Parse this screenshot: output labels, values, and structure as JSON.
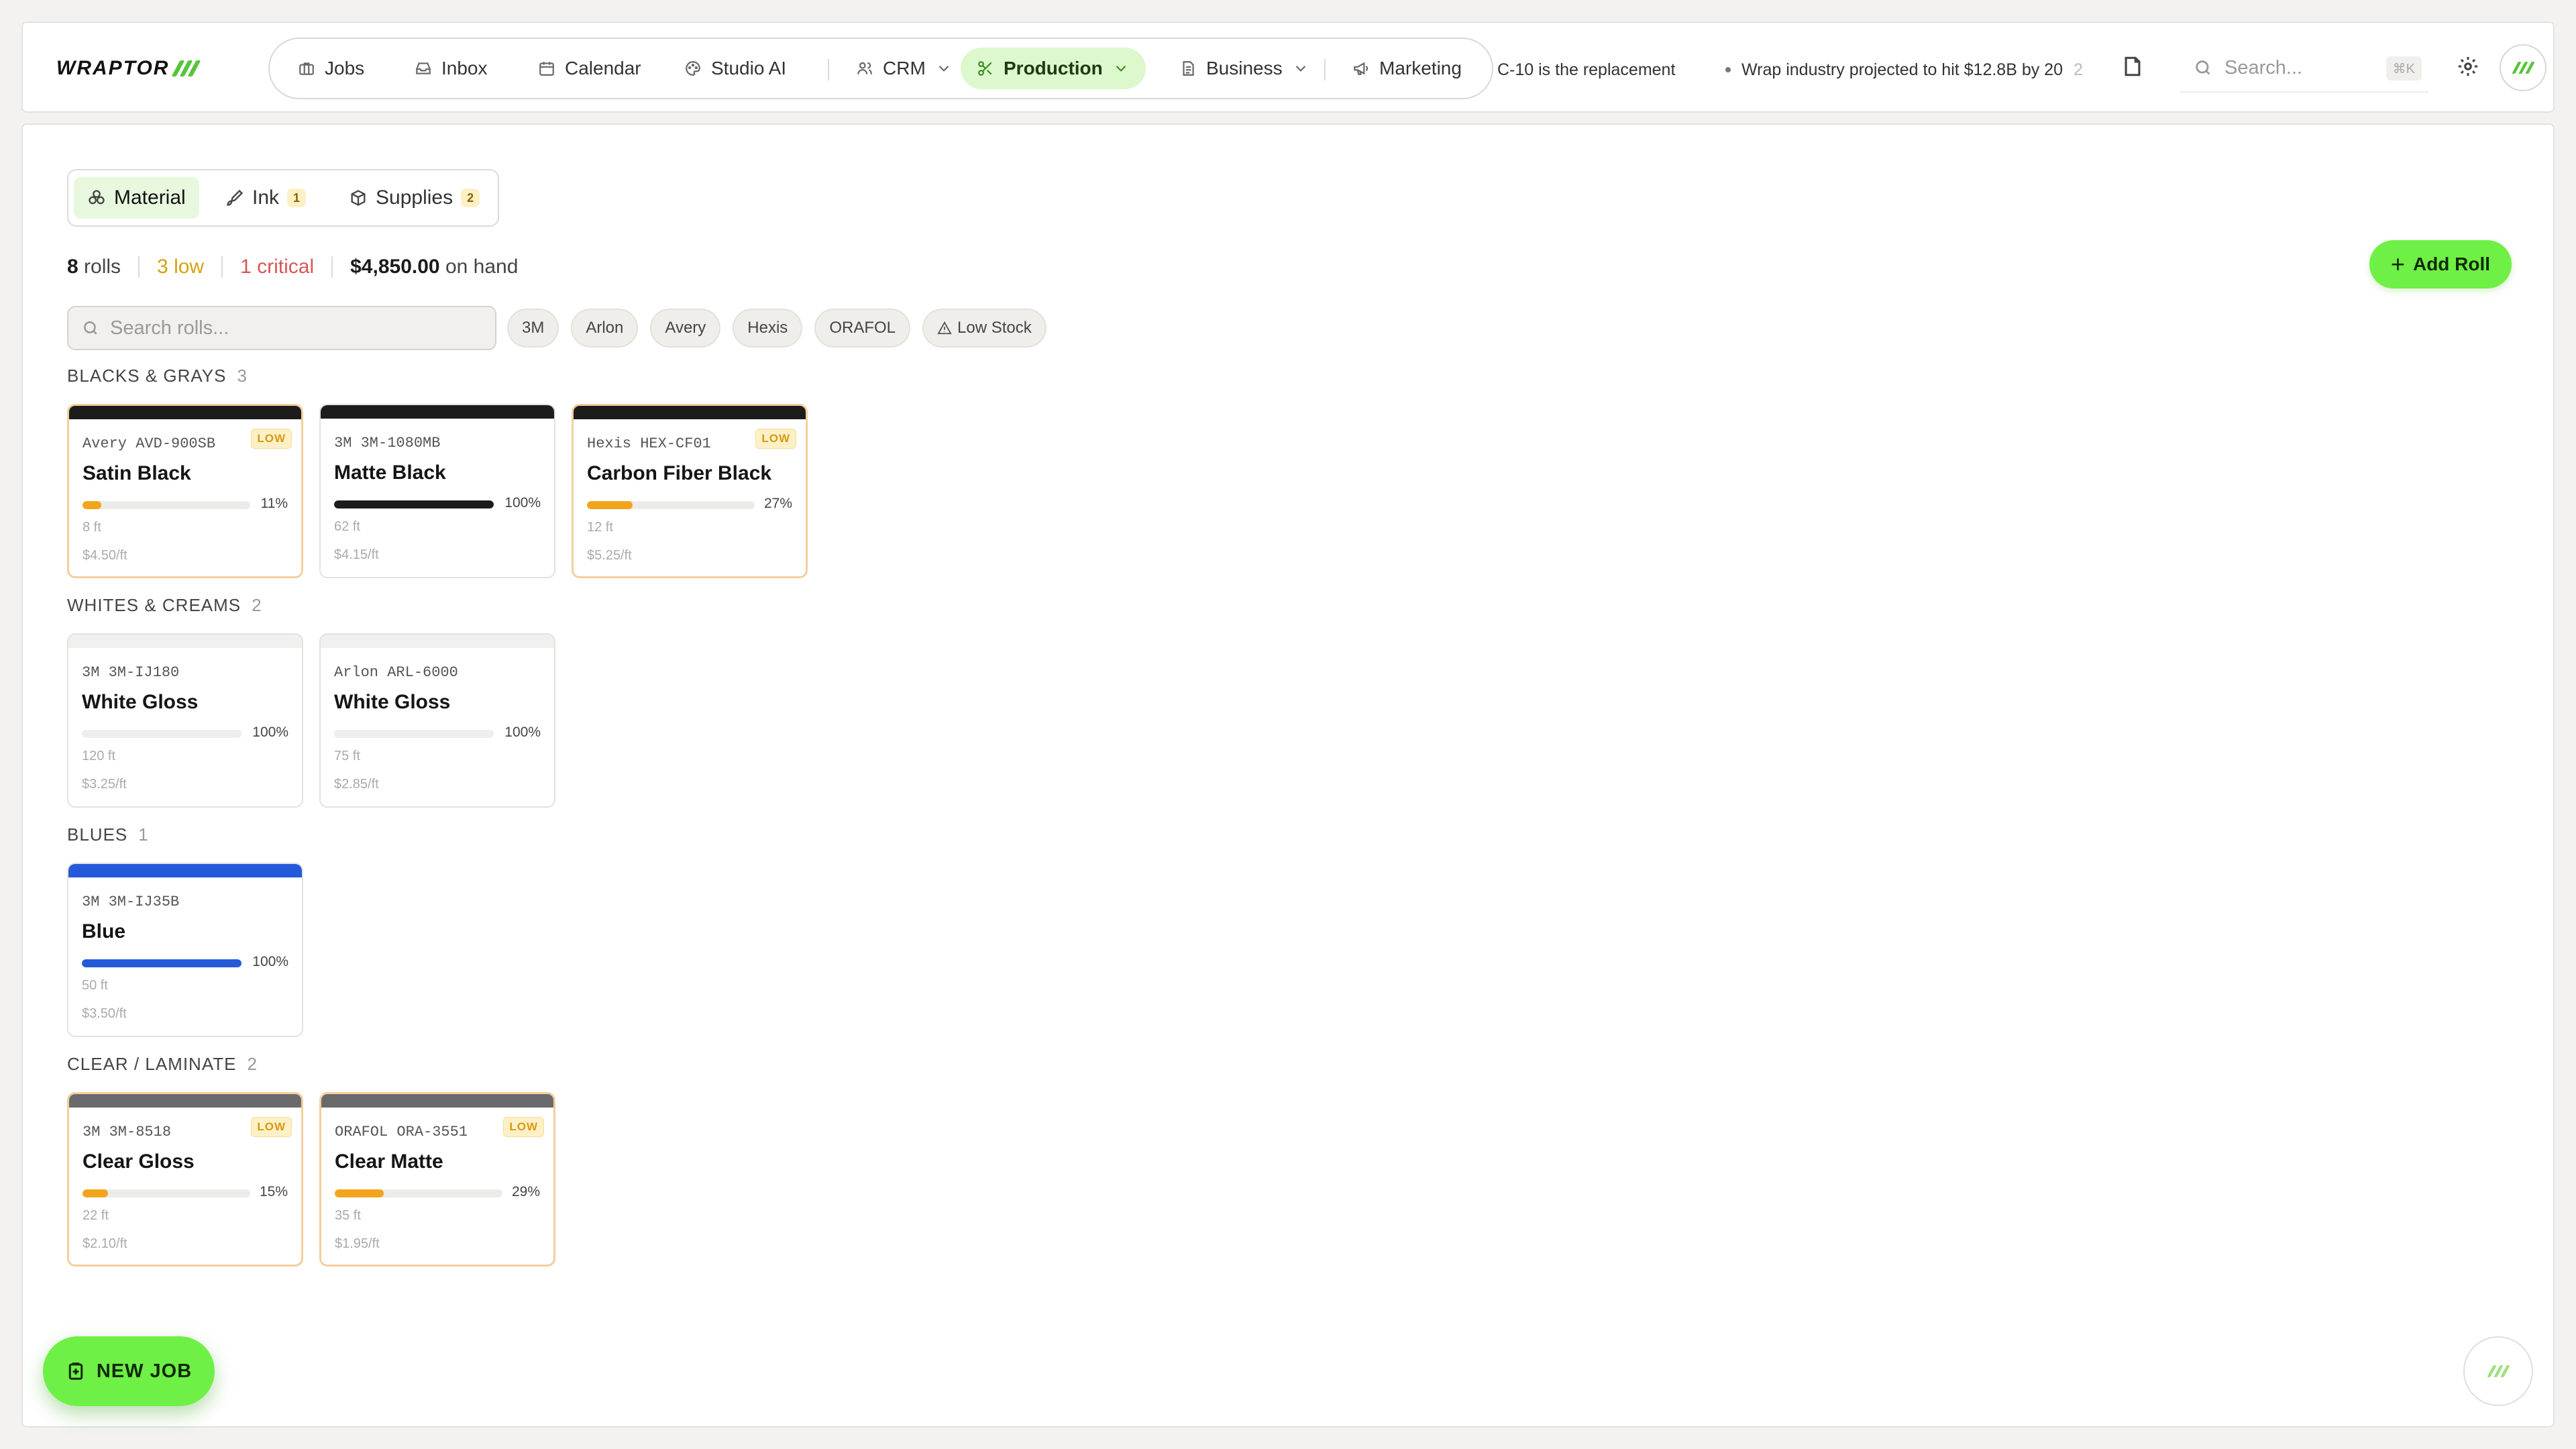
{
  "app": {
    "logo_text": "WRAPTOR",
    "accent_color": "#6ef046"
  },
  "nav": {
    "items": [
      {
        "label": "Jobs",
        "icon": "briefcase-icon"
      },
      {
        "label": "Inbox",
        "icon": "inbox-icon"
      },
      {
        "label": "Calendar",
        "icon": "calendar-icon"
      },
      {
        "label": "Studio AI",
        "icon": "palette-icon"
      },
      {
        "label": "CRM",
        "icon": "users-icon"
      },
      {
        "label": "Production",
        "icon": "scissors-icon",
        "active": true
      },
      {
        "label": "Business",
        "icon": "document-icon"
      },
      {
        "label": "Marketing",
        "icon": "megaphone-icon"
      }
    ]
  },
  "ticker": {
    "item1": "C-10 is the replacement",
    "item2": "Wrap industry projected to hit $12.8B by 20",
    "item2_fade": "2"
  },
  "search": {
    "placeholder": "Search...",
    "shortcut": "⌘K"
  },
  "tabs": [
    {
      "label": "Material",
      "icon": "material-icon",
      "badge": ""
    },
    {
      "label": "Ink",
      "icon": "ink-icon",
      "badge": "1"
    },
    {
      "label": "Supplies",
      "icon": "box-icon",
      "badge": "2"
    }
  ],
  "stats": {
    "rolls_count": "8",
    "rolls_label": "rolls",
    "low": "3 low",
    "critical": "1 critical",
    "value": "$4,850.00",
    "value_label": "on hand"
  },
  "add_roll_label": "Add Roll",
  "roll_search_placeholder": "Search rolls...",
  "filters": [
    "3M",
    "Arlon",
    "Avery",
    "Hexis",
    "ORAFOL",
    "Low Stock"
  ],
  "groups": [
    {
      "title": "BLACKS & GRAYS",
      "count": "3",
      "rolls": [
        {
          "code": "Avery AVD-900SB",
          "name": "Satin Black",
          "percent": 11,
          "pct_label": "11%",
          "length": "8 ft",
          "price": "$4.50/ft",
          "low": true,
          "low_label": "LOW",
          "stripe": "#1c1c1c",
          "fill": "#f2a51c"
        },
        {
          "code": "3M 3M-1080MB",
          "name": "Matte Black",
          "percent": 100,
          "pct_label": "100%",
          "length": "62 ft",
          "price": "$4.15/ft",
          "low": false,
          "stripe": "#1c1c1c",
          "fill": "#1c1c1c"
        },
        {
          "code": "Hexis HEX-CF01",
          "name": "Carbon Fiber Black",
          "percent": 27,
          "pct_label": "27%",
          "length": "12 ft",
          "price": "$5.25/ft",
          "low": true,
          "low_label": "LOW",
          "stripe": "#1c1c1c",
          "fill": "#f2a51c"
        }
      ]
    },
    {
      "title": "WHITES & CREAMS",
      "count": "2",
      "rolls": [
        {
          "code": "3M 3M-IJ180",
          "name": "White Gloss",
          "percent": 100,
          "pct_label": "100%",
          "length": "120 ft",
          "price": "$3.25/ft",
          "low": false,
          "stripe": "#f1f0ee",
          "fill": "#efeeec"
        },
        {
          "code": "Arlon ARL-6000",
          "name": "White Gloss",
          "percent": 100,
          "pct_label": "100%",
          "length": "75 ft",
          "price": "$2.85/ft",
          "low": false,
          "stripe": "#f1f0ee",
          "fill": "#efeeec"
        }
      ]
    },
    {
      "title": "BLUES",
      "count": "1",
      "rolls": [
        {
          "code": "3M 3M-IJ35B",
          "name": "Blue",
          "percent": 100,
          "pct_label": "100%",
          "length": "50 ft",
          "price": "$3.50/ft",
          "low": false,
          "stripe": "#2459d9",
          "fill": "#2459d9"
        }
      ]
    },
    {
      "title": "CLEAR / LAMINATE",
      "count": "2",
      "rolls": [
        {
          "code": "3M 3M-8518",
          "name": "Clear Gloss",
          "percent": 15,
          "pct_label": "15%",
          "length": "22 ft",
          "price": "$2.10/ft",
          "low": true,
          "low_label": "LOW",
          "stripe": "#6a6a6d",
          "fill": "#f2a51c"
        },
        {
          "code": "ORAFOL ORA-3551",
          "name": "Clear Matte",
          "percent": 29,
          "pct_label": "29%",
          "length": "35 ft",
          "price": "$1.95/ft",
          "low": true,
          "low_label": "LOW",
          "stripe": "#6a6a6d",
          "fill": "#f2a51c"
        }
      ]
    }
  ],
  "new_job_label": "NEW JOB"
}
